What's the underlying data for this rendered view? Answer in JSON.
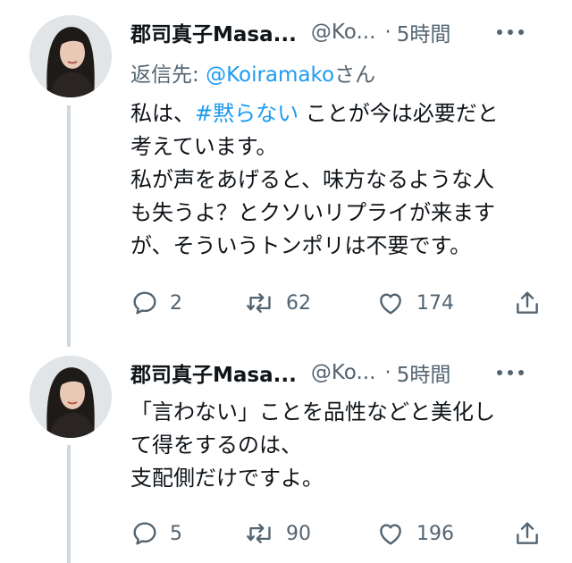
{
  "tweets": [
    {
      "author_name": "郡司真子Masa...",
      "handle": "@Ko...",
      "separator": "·",
      "time": "5時間",
      "reply_label": "返信先: ",
      "reply_mention": "@Koiramako",
      "reply_suffix": "さん",
      "lines": [
        {
          "pre": "私は、",
          "hashtag": "#黙らない",
          "post": " ことが今は必要だと"
        },
        {
          "text": "考えています。"
        },
        {
          "text": "私が声をあげると、味方なるような人"
        },
        {
          "text": "も失うよ？とクソいリプライが来ます"
        },
        {
          "text": "が、そういうトンポリは不要です。"
        }
      ],
      "replies": "2",
      "retweets": "62",
      "likes": "174"
    },
    {
      "author_name": "郡司真子Masa...",
      "handle": "@Ko...",
      "separator": "·",
      "time": "5時間",
      "lines": [
        {
          "text": "「言わない」ことを品性などと美化し"
        },
        {
          "text": "て得をするのは、"
        },
        {
          "text": "支配側だけですよ。"
        }
      ],
      "replies": "5",
      "retweets": "90",
      "likes": "196"
    }
  ],
  "icons": [
    "avatar",
    "more-icon",
    "reply-icon",
    "retweet-icon",
    "like-icon",
    "share-icon"
  ],
  "colors": {
    "link": "#1d9bf0",
    "secondary_text": "#536471",
    "thread_line": "#cfd9de"
  }
}
